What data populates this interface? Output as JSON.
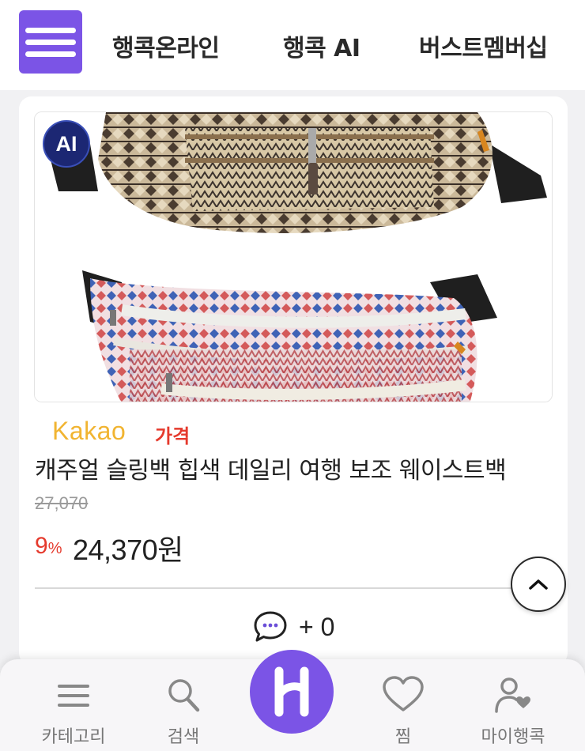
{
  "nav": {
    "tabs": [
      "행콕온라인",
      "행콕 AI",
      "버스트멤버십"
    ]
  },
  "product": {
    "badge": "AI",
    "brand": "Kakao",
    "price_tag": "가격",
    "title": "캐주얼 슬링백 힙색 데일리 여행 보조 웨이스트백",
    "original_price": "27,070",
    "discount_num": "9",
    "discount_unit": "%",
    "sale_price": "24,370원",
    "comment_count": "+ 0"
  },
  "tabbar": {
    "category": "카테고리",
    "search": "검색",
    "wishlist": "찜",
    "my": "마이행콕"
  },
  "colors": {
    "accent": "#7b54e6",
    "sale": "#e53a2d",
    "brand": "#f1b431"
  },
  "icons": [
    "menu-icon",
    "ai-badge-icon",
    "comment-icon",
    "chevron-up-icon",
    "list-icon",
    "search-icon",
    "home-logo-icon",
    "heart-icon",
    "user-heart-icon"
  ]
}
